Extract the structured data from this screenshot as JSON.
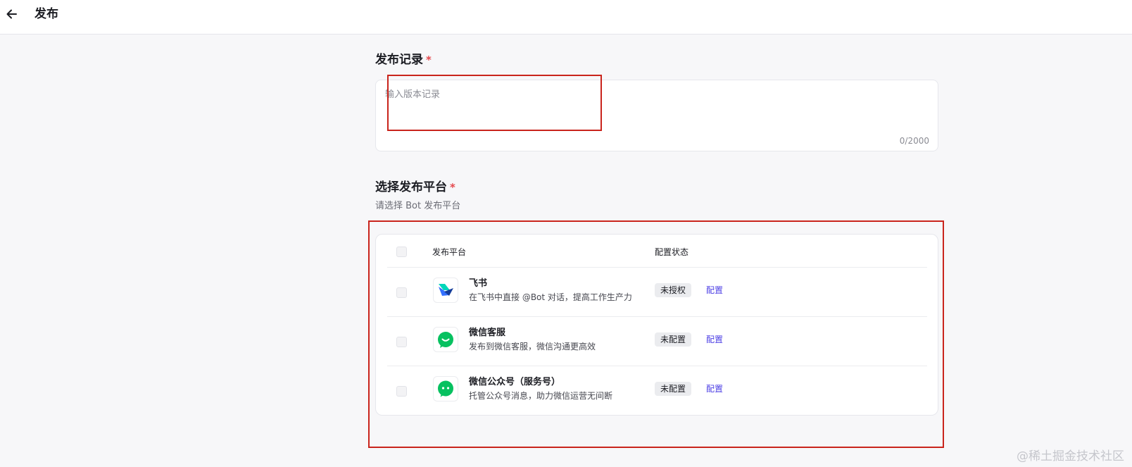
{
  "header": {
    "title": "发布"
  },
  "record": {
    "title": "发布记录",
    "required_mark": "*",
    "placeholder": "输入版本记录",
    "char_count": "0/2000"
  },
  "platform": {
    "title": "选择发布平台",
    "required_mark": "*",
    "subtitle": "请选择 Bot 发布平台",
    "columns": {
      "platform": "发布平台",
      "status": "配置状态"
    },
    "rows": [
      {
        "name": "飞书",
        "desc": "在飞书中直接 @Bot 对话，提高工作生产力",
        "status": "未授权",
        "action": "配置",
        "icon": "feishu-logo-icon"
      },
      {
        "name": "微信客服",
        "desc": "发布到微信客服，微信沟通更高效",
        "status": "未配置",
        "action": "配置",
        "icon": "wechat-customer-service-icon"
      },
      {
        "name": "微信公众号（服务号）",
        "desc": "托管公众号消息，助力微信运营无间断",
        "status": "未配置",
        "action": "配置",
        "icon": "wechat-official-account-icon"
      }
    ]
  },
  "colors": {
    "accent_link": "#4e40e5",
    "required": "#e5484d",
    "highlight_box": "#c9241c",
    "wechat_green": "#07c160"
  },
  "watermark": "@稀土掘金技术社区"
}
